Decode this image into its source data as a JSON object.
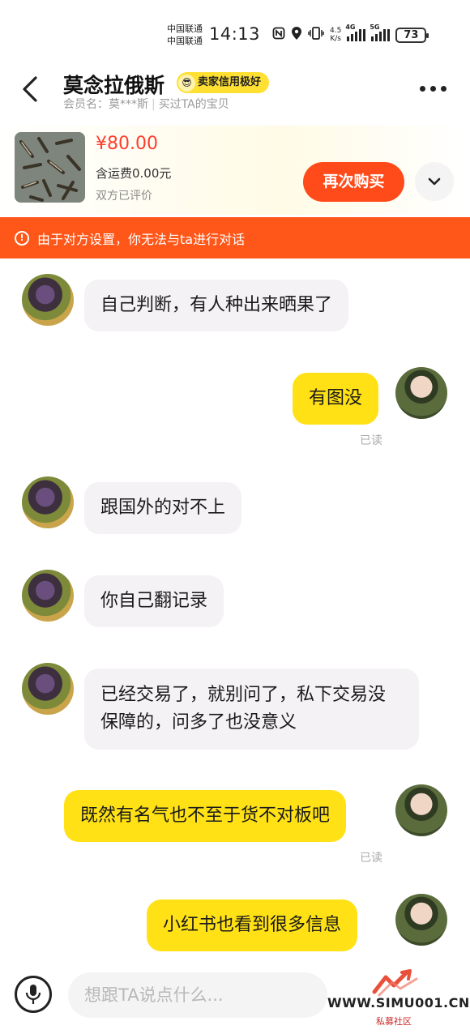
{
  "status_bar": {
    "carrier_1": "中国联通",
    "carrier_2": "中国联通",
    "time": "14:13",
    "net_speed_value": "4.5",
    "net_speed_unit": "K/s",
    "signal_1_label": "4G",
    "signal_2_label": "5G",
    "battery": "73"
  },
  "header": {
    "seller_name": "莫念拉俄斯",
    "credit_badge": "卖家信用极好",
    "member_label": "会员名：莫***斯",
    "bought_label": "买过TA的宝贝"
  },
  "product": {
    "price": "¥80.00",
    "shipping": "含运费0.00元",
    "review_status": "双方已评价",
    "buy_again_label": "再次购买"
  },
  "notice": {
    "text": "由于对方设置，你无法与ta进行对话"
  },
  "messages": [
    {
      "side": "in",
      "text": "自己判断，有人种出来晒果了"
    },
    {
      "side": "out",
      "text": "有图没",
      "status": "已读"
    },
    {
      "side": "in",
      "text": "跟国外的对不上"
    },
    {
      "side": "in",
      "text": "你自己翻记录"
    },
    {
      "side": "in",
      "text": "已经交易了，就别问了，私下交易没保障的，问多了也没意义"
    },
    {
      "side": "out",
      "text": "既然有名气也不至于货不对板吧",
      "status": "已读"
    },
    {
      "side": "out",
      "text": "小红书也看到很多信息"
    }
  ],
  "input": {
    "placeholder": "想跟TA说点什么..."
  },
  "watermark": {
    "site": "WWW.SIMU001.CN",
    "sub": "私募社区"
  },
  "colors": {
    "accent_orange": "#ff4a1a",
    "notice_bg": "#ff5719",
    "price_red": "#ff3d2e",
    "outgoing_bubble": "#ffe116",
    "incoming_bubble": "#f4f2f4",
    "badge_yellow": "#ffe033"
  }
}
